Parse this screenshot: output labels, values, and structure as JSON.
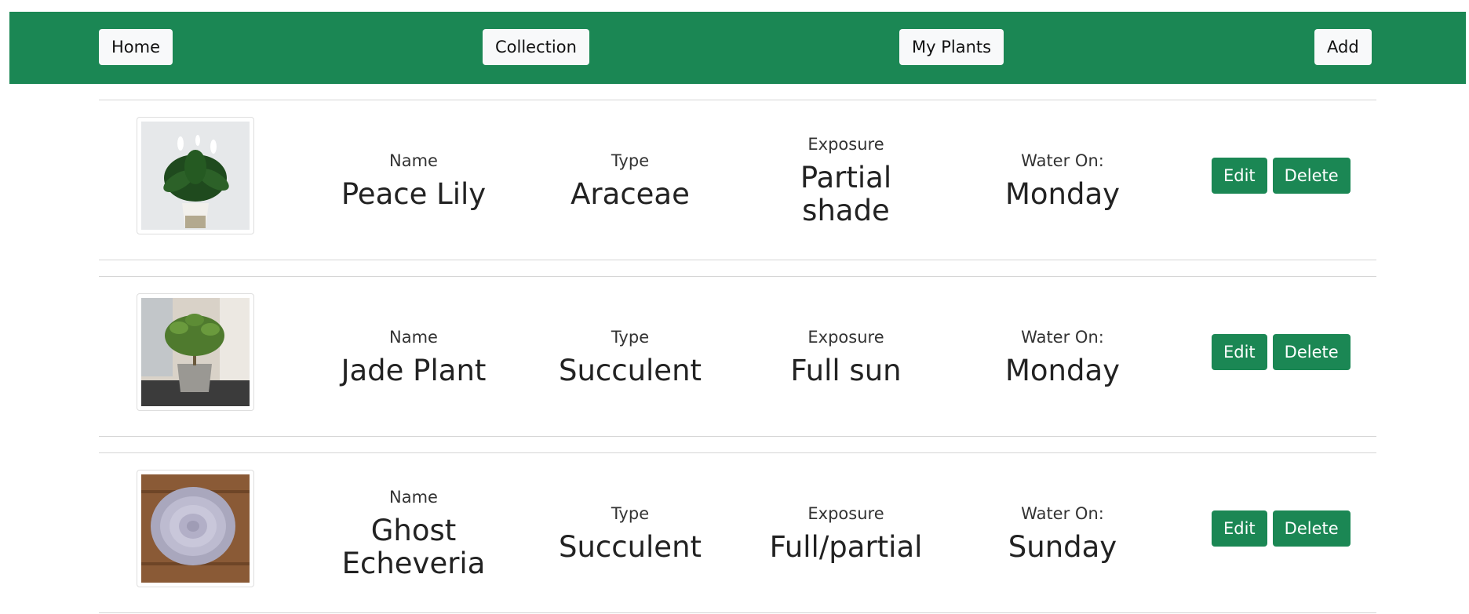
{
  "nav": {
    "home_label": "Home",
    "collection_label": "Collection",
    "my_plants_label": "My Plants",
    "add_label": "Add"
  },
  "labels": {
    "name": "Name",
    "type": "Type",
    "exposure": "Exposure",
    "water_on": "Water On:"
  },
  "actions": {
    "edit_label": "Edit",
    "delete_label": "Delete"
  },
  "plants": [
    {
      "name": "Peace Lily",
      "type": "Araceae",
      "exposure": "Partial shade",
      "water_on": "Monday",
      "image": "peace-lily-photo"
    },
    {
      "name": "Jade Plant",
      "type": "Succulent",
      "exposure": "Full sun",
      "water_on": "Monday",
      "image": "jade-plant-photo"
    },
    {
      "name": "Ghost Echeveria",
      "type": "Succulent",
      "exposure": "Full/partial",
      "water_on": "Sunday",
      "image": "ghost-echeveria-photo"
    }
  ],
  "colors": {
    "brand_green": "#1b8754",
    "nav_button_bg": "#f8f9fa"
  }
}
